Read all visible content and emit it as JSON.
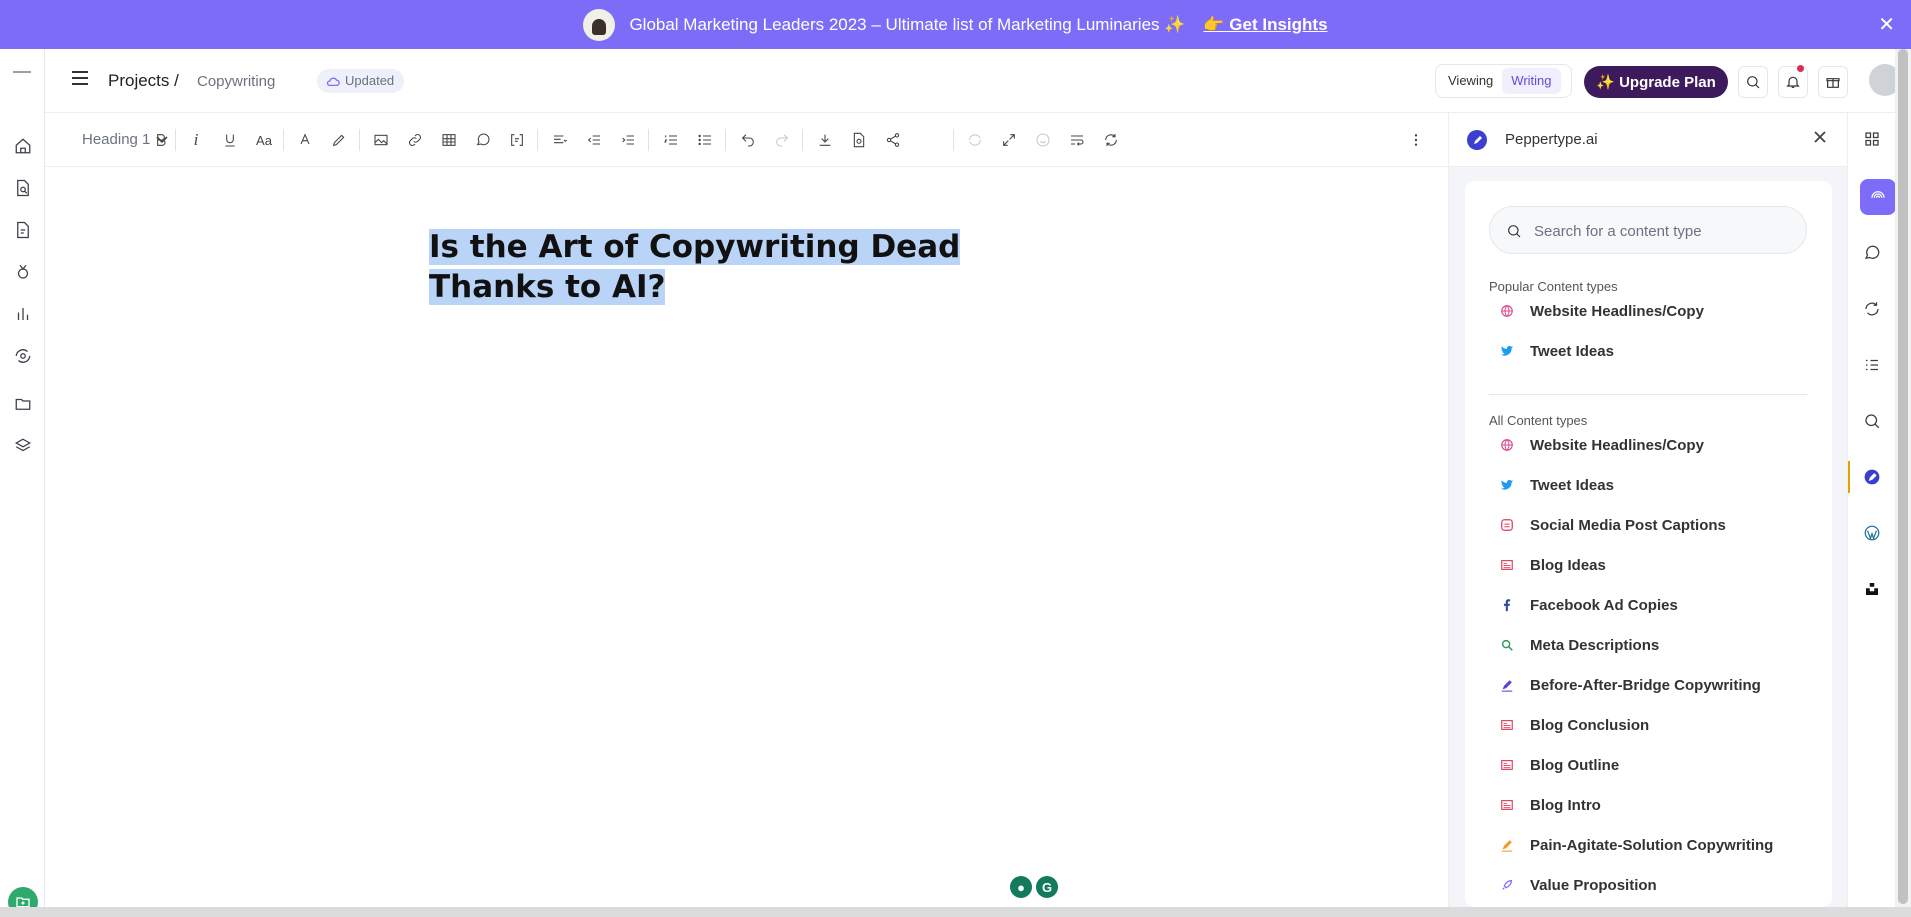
{
  "banner": {
    "text": "Global Marketing Leaders 2023 – Ultimate list of Marketing Luminaries ✨",
    "cta": "👉 Get Insights",
    "close": "✕"
  },
  "header": {
    "breadcrumb_root": "Projects /",
    "breadcrumb_current": "Copywriting",
    "status": "Updated",
    "mode_viewing": "Viewing",
    "mode_writing": "Writing",
    "upgrade_label": "✨ Upgrade Plan"
  },
  "toolbar": {
    "block_type": "Heading 1",
    "italic": "i",
    "font_size": "Aa"
  },
  "editor": {
    "title": "Is the Art of Copywriting Dead Thanks to AI?"
  },
  "panel": {
    "title": "Peppertype.ai",
    "search_placeholder": "Search for a content type",
    "popular_label": "Popular Content types",
    "all_label": "All Content types",
    "popular": [
      {
        "label": "Website Headlines/Copy",
        "icon": "globe-icon"
      },
      {
        "label": "Tweet Ideas",
        "icon": "twitter-icon"
      }
    ],
    "all": [
      {
        "label": "Website Headlines/Copy",
        "icon": "globe-icon"
      },
      {
        "label": "Tweet Ideas",
        "icon": "twitter-icon"
      },
      {
        "label": "Social Media Post Captions",
        "icon": "social-post-icon"
      },
      {
        "label": "Blog Ideas",
        "icon": "blog-icon"
      },
      {
        "label": "Facebook Ad Copies",
        "icon": "facebook-icon"
      },
      {
        "label": "Meta Descriptions",
        "icon": "magnifier-icon"
      },
      {
        "label": "Before-After-Bridge Copywriting",
        "icon": "pen-icon"
      },
      {
        "label": "Blog Conclusion",
        "icon": "blog-icon"
      },
      {
        "label": "Blog Outline",
        "icon": "blog-icon"
      },
      {
        "label": "Blog Intro",
        "icon": "blog-icon"
      },
      {
        "label": "Pain-Agitate-Solution Copywriting",
        "icon": "pen-icon"
      },
      {
        "label": "Value Proposition",
        "icon": "rocket-icon"
      }
    ]
  },
  "colors": {
    "banner_bg": "#7c6cf8",
    "upgrade_bg": "#3d1a5b",
    "selection": "#b9d4f7",
    "accent": "#5b4fd6"
  }
}
